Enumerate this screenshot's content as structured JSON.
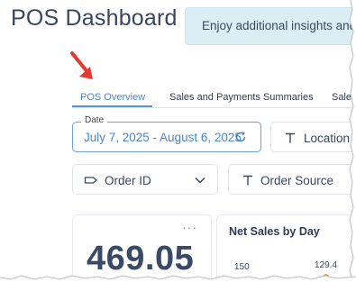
{
  "header": {
    "title": "POS Dashboard",
    "banner_text": "Enjoy additional insights and"
  },
  "tabs": [
    {
      "label": "POS Overview",
      "active": true
    },
    {
      "label": "Sales and Payments Summaries",
      "active": false
    },
    {
      "label": "Sale",
      "active": false
    }
  ],
  "filters": {
    "date": {
      "label": "Date",
      "value": "July 7, 2025 - August 6, 2025"
    },
    "location": {
      "label": "Location"
    },
    "order_id": {
      "label": "Order ID"
    },
    "order_source": {
      "label": "Order Source"
    }
  },
  "kpi_card": {
    "value": "469.05",
    "menu_glyph": "···"
  },
  "chart": {
    "title": "Net Sales by Day",
    "y_tick": "150",
    "data_label": "129.4"
  },
  "colors": {
    "accent": "#4f86c6",
    "banner_bg": "#dbeef4",
    "annotation_arrow": "#e53935"
  },
  "chart_data": {
    "type": "bar",
    "title": "Net Sales by Day",
    "y_ticks": [
      150
    ],
    "data_labels": [
      129.4
    ]
  }
}
